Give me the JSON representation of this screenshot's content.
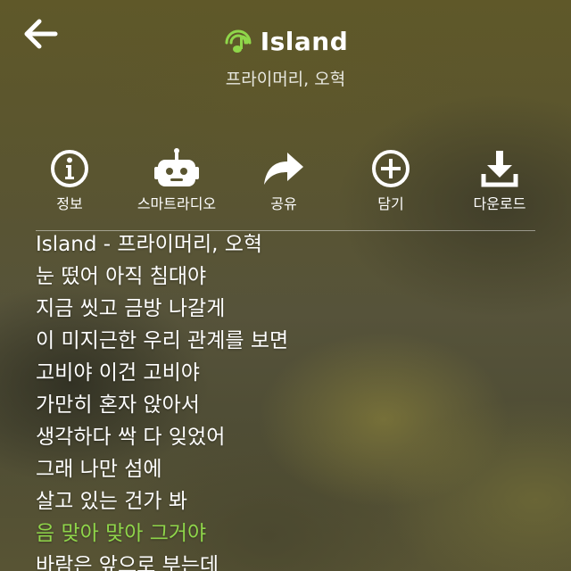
{
  "header": {
    "title": "Island",
    "artist": "프라이머리, 오혁",
    "accent_color": "#8fd64a"
  },
  "icons": {
    "back": "back-arrow-icon",
    "music": "music-note-icon"
  },
  "actions": [
    {
      "label": "정보",
      "icon": "info-icon"
    },
    {
      "label": "스마트라디오",
      "icon": "smart-radio-icon"
    },
    {
      "label": "공유",
      "icon": "share-icon"
    },
    {
      "label": "담기",
      "icon": "add-icon"
    },
    {
      "label": "다운로드",
      "icon": "download-icon"
    }
  ],
  "lyrics": {
    "current_index": 9,
    "lines": [
      "Island - 프라이머리, 오혁",
      "눈 떴어 아직 침대야",
      "지금 씻고 금방 나갈게",
      "이 미지근한 우리 관계를 보면",
      "고비야 이건 고비야",
      "가만히 혼자 앉아서",
      "생각하다 싹 다 잊었어",
      "그래 나만 섬에",
      "살고 있는 건가 봐",
      "음 맞아 맞아 그거야",
      "바람은 앞으로 부는데"
    ]
  }
}
